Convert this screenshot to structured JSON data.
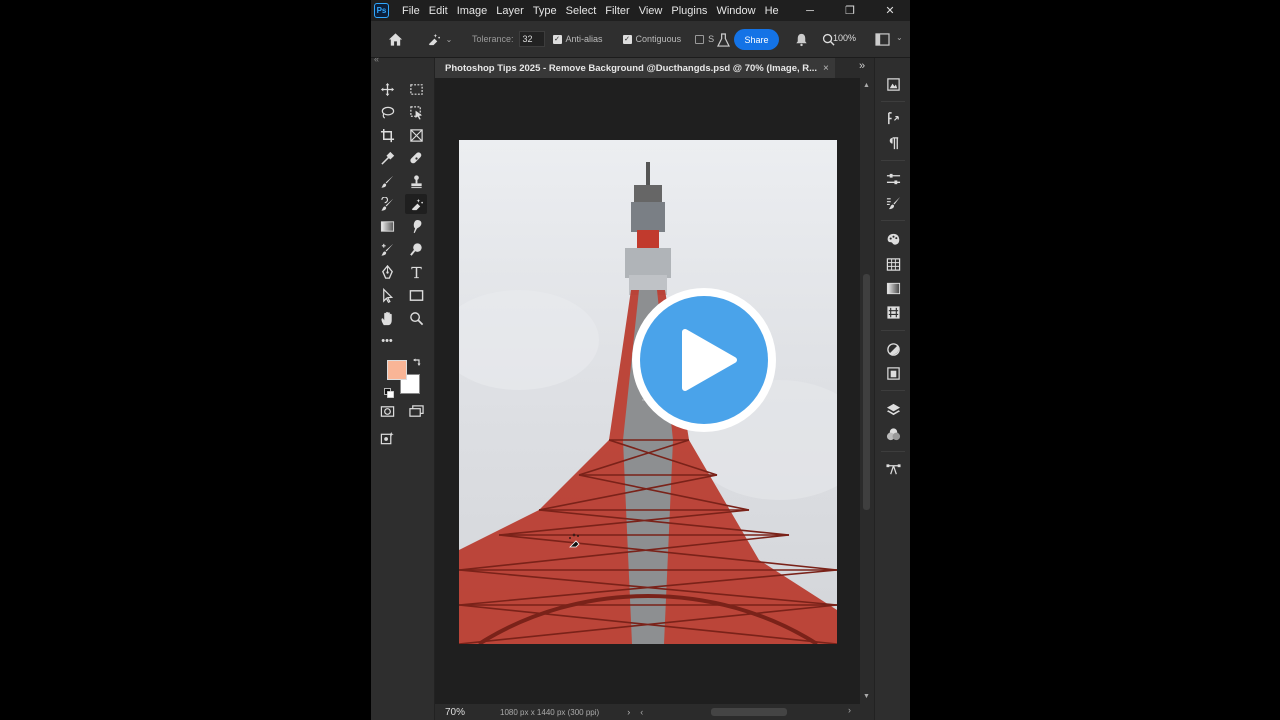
{
  "app": {
    "logo": "Ps",
    "menu": [
      "File",
      "Edit",
      "Image",
      "Layer",
      "Type",
      "Select",
      "Filter",
      "View",
      "Plugins",
      "Window",
      "He"
    ],
    "window_controls": {
      "minimize": "─",
      "restore": "❐",
      "close": "✕"
    }
  },
  "options_bar": {
    "tolerance_label": "Tolerance:",
    "tolerance_value": "32",
    "anti_alias_label": "Anti-alias",
    "anti_alias_checked": true,
    "contiguous_label": "Contiguous",
    "contiguous_checked": true,
    "sample_label": "S",
    "share_label": "Share",
    "zoom_readout": "100%",
    "chevron": "⌄"
  },
  "toolbar": {
    "collapse": "«",
    "foreground_color": "#f9b596",
    "background_color": "#ffffff",
    "more_label": "•••"
  },
  "document": {
    "tab_title": "Photoshop Tips 2025 - Remove Background @Ducthangds.psd @ 70% (Image, R...",
    "tab_close": "×",
    "expand": "»"
  },
  "status_bar": {
    "zoom": "70%",
    "dimensions": "1080 px x 1440 px (300 ppi)",
    "arrow": "›",
    "scroll_left": "‹",
    "scroll_right": "›"
  },
  "scroll": {
    "up": "▲",
    "down": "▼"
  },
  "overlay": {
    "play_color": "#4aa3ea"
  },
  "colors": {
    "accent": "#1473e6",
    "tower_red": "#b8382b"
  }
}
